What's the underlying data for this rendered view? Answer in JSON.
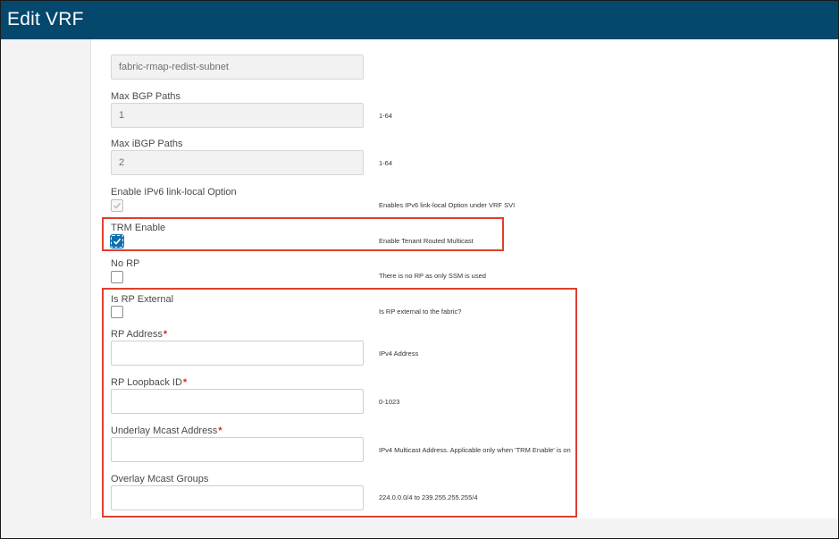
{
  "window": {
    "title": "Edit VRF"
  },
  "form": {
    "route_map": {
      "value": "fabric-rmap-redist-subnet"
    },
    "max_bgp_paths": {
      "label": "Max BGP Paths",
      "value": "1",
      "hint": "1-64"
    },
    "max_ibgp_paths": {
      "label": "Max iBGP Paths",
      "value": "2",
      "hint": "1-64"
    },
    "ipv6_link_local": {
      "label": "Enable IPv6 link-local Option",
      "checked": true,
      "disabled": true,
      "hint": "Enables IPv6 link-local Option under VRF SVI"
    },
    "trm_enable": {
      "label": "TRM Enable",
      "checked": true,
      "hint": "Enable Tenant Routed Multicast"
    },
    "no_rp": {
      "label": "No RP",
      "checked": false,
      "hint": "There is no RP as only SSM is used"
    },
    "is_rp_external": {
      "label": "Is RP External",
      "checked": false,
      "hint": "Is RP external to the fabric?"
    },
    "rp_address": {
      "label": "RP Address",
      "required_mark": "*",
      "value": "",
      "hint": "IPv4 Address"
    },
    "rp_loopback_id": {
      "label": "RP Loopback ID",
      "required_mark": "*",
      "value": "",
      "hint": "0-1023"
    },
    "underlay_mcast_address": {
      "label": "Underlay Mcast Address",
      "required_mark": "*",
      "value": "",
      "hint": "IPv4 Multicast Address. Applicable only when 'TRM Enable' is on"
    },
    "overlay_mcast_groups": {
      "label": "Overlay Mcast Groups",
      "value": "",
      "hint": "224.0.0.0/4 to 239.255.255.255/4"
    }
  },
  "colors": {
    "header": "#04486d",
    "highlight": "#df3f2f",
    "checkbox_checked": "#0d6fae",
    "required": "#d9281f"
  }
}
